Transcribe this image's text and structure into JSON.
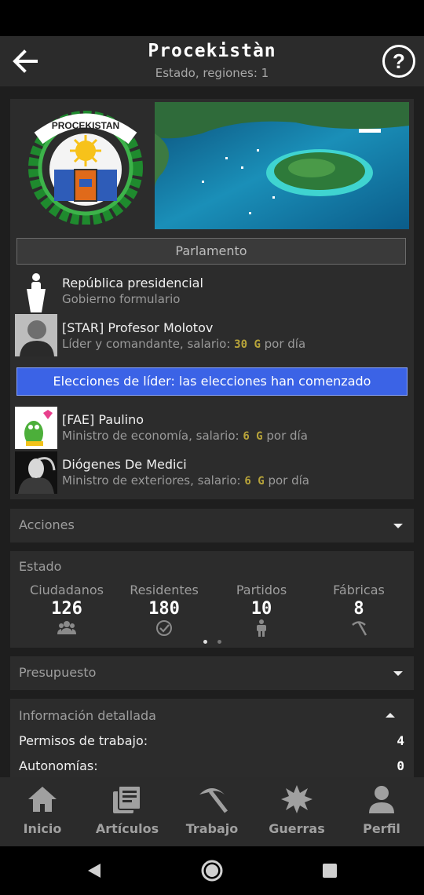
{
  "header": {
    "title": "Procekistàn",
    "subtitle": "Estado, regiones: 1"
  },
  "top_card": {
    "emblem_text": "PROCEKISTAN",
    "parliament_button": "Parlamento",
    "government": {
      "title": "República presidencial",
      "subtitle": "Gobierno formulario"
    },
    "leader": {
      "name": "[STAR] Profesor Molotov",
      "role_prefix": "Líder y comandante, salario: ",
      "salary": "30 G",
      "suffix": " por día"
    },
    "elections_banner": "Elecciones de líder: las elecciones han comenzado",
    "ministers": [
      {
        "name": "[FAE] Paulino",
        "role_prefix": "Ministro de economía, salario: ",
        "salary": "6 G",
        "suffix": " por día"
      },
      {
        "name": "Diógenes De Medici",
        "role_prefix": "Ministro de exteriores, salario: ",
        "salary": "6 G",
        "suffix": " por día"
      }
    ]
  },
  "actions": {
    "label": "Acciones"
  },
  "estado": {
    "label": "Estado",
    "stats": [
      {
        "label": "Ciudadanos",
        "value": "126",
        "icon": "people-icon"
      },
      {
        "label": "Residentes",
        "value": "180",
        "icon": "check-circle-icon"
      },
      {
        "label": "Partidos",
        "value": "10",
        "icon": "person-icon"
      },
      {
        "label": "Fábricas",
        "value": "8",
        "icon": "pickaxe-icon"
      }
    ],
    "pager_pages": 2,
    "pager_active": 1
  },
  "budget": {
    "label": "Presupuesto"
  },
  "details": {
    "label": "Información detallada",
    "rows": [
      {
        "label": "Permisos de trabajo:",
        "value": "4"
      },
      {
        "label": "Autonomías:",
        "value": "0"
      }
    ]
  },
  "bottom_nav": [
    {
      "label": "Inicio",
      "icon": "home-icon"
    },
    {
      "label": "Artículos",
      "icon": "articles-icon"
    },
    {
      "label": "Trabajo",
      "icon": "hammer-icon"
    },
    {
      "label": "Guerras",
      "icon": "explosion-icon"
    },
    {
      "label": "Perfil",
      "icon": "person-icon"
    }
  ],
  "colors": {
    "accent_blue": "#3b63e6",
    "salary_gold": "#b8a43a",
    "card_bg": "#2c2c2c",
    "appbar_bg": "#2b2b2b"
  }
}
